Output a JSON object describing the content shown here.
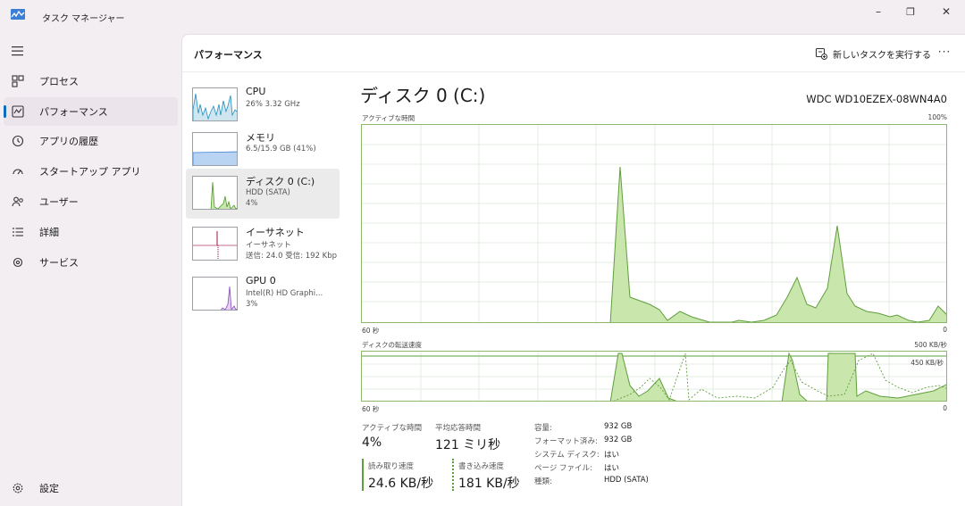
{
  "window": {
    "title": "タスク マネージャー",
    "controls": {
      "minimize": "–",
      "maximize": "❐",
      "close": "✕"
    }
  },
  "sidebar": {
    "items": [
      {
        "label": "プロセス",
        "icon": "processes-icon"
      },
      {
        "label": "パフォーマンス",
        "icon": "performance-icon",
        "active": true
      },
      {
        "label": "アプリの履歴",
        "icon": "app-history-icon"
      },
      {
        "label": "スタートアップ アプリ",
        "icon": "startup-apps-icon"
      },
      {
        "label": "ユーザー",
        "icon": "users-icon"
      },
      {
        "label": "詳細",
        "icon": "details-icon"
      },
      {
        "label": "サービス",
        "icon": "services-icon"
      }
    ],
    "settings": {
      "label": "設定",
      "icon": "settings-gear-icon"
    }
  },
  "header": {
    "title": "パフォーマンス",
    "run_task_label": "新しいタスクを実行する",
    "more_label": "···"
  },
  "devices": [
    {
      "name": "CPU",
      "sub1": "26% 3.32 GHz",
      "sub2": "",
      "color": "#1f8fbf"
    },
    {
      "name": "メモリ",
      "sub1": "6.5/15.9 GB (41%)",
      "sub2": "",
      "color": "#3a7fd5"
    },
    {
      "name": "ディスク 0 (C:)",
      "sub1": "HDD (SATA)",
      "sub2": "4%",
      "color": "#4e9a2a",
      "selected": true
    },
    {
      "name": "イーサネット",
      "sub1": "イーサネット",
      "sub2": "送信: 24.0 受信: 192 Kbp",
      "color": "#b1386a"
    },
    {
      "name": "GPU 0",
      "sub1": "Intel(R) HD Graphi...",
      "sub2": "3%",
      "color": "#8a4ac0"
    }
  ],
  "detail": {
    "title": "ディスク 0 (C:)",
    "model": "WDC WD10EZEX-08WN4A0",
    "active_graph": {
      "label": "アクティブな時間",
      "max_label": "100%",
      "time_label": "60 秒",
      "min_label": "0"
    },
    "transfer_graph": {
      "label": "ディスクの転送速度",
      "max_label": "500 KB/秒",
      "ref_label": "450 KB/秒",
      "time_label": "60 秒",
      "min_label": "0"
    },
    "stats": {
      "active_time_label": "アクティブな時間",
      "active_time_value": "4%",
      "avg_response_label": "平均応答時間",
      "avg_response_value": "121 ミリ秒",
      "read_speed_label": "読み取り速度",
      "read_speed_value": "24.6 KB/秒",
      "write_speed_label": "書き込み速度",
      "write_speed_value": "181 KB/秒"
    },
    "properties": [
      {
        "label": "容量:",
        "value": "932 GB"
      },
      {
        "label": "フォーマット済み:",
        "value": "932 GB"
      },
      {
        "label": "システム ディスク:",
        "value": "はい"
      },
      {
        "label": "ページ ファイル:",
        "value": "はい"
      },
      {
        "label": "種類:",
        "value": "HDD (SATA)"
      }
    ]
  },
  "colors": {
    "accent": "#0f6cbd",
    "disk_line": "#5f9e3b",
    "disk_fill": "#c9e7ad"
  }
}
